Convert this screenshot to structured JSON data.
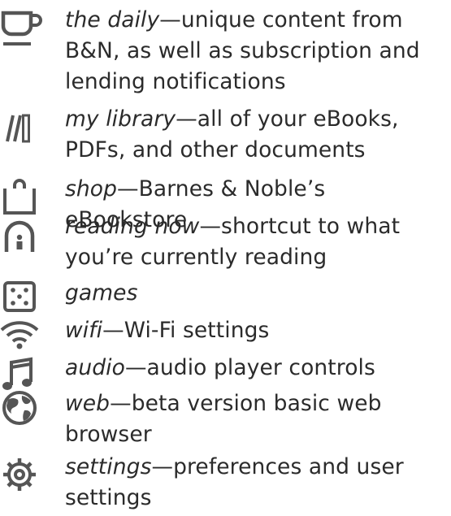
{
  "items": [
    {
      "term": "the daily",
      "desc": "—unique content from B&N, as well as subscription and lending notifications",
      "icon": "cup-icon"
    },
    {
      "term": "my library",
      "desc": "—all of your eBooks, PDFs, and other documents",
      "icon": "library-icon"
    },
    {
      "term": "shop",
      "desc": "—Barnes & Noble’s eBookstore",
      "icon": "shopping-bag-icon"
    },
    {
      "term": "reading now",
      "desc": "—shortcut to what you’re currently reading",
      "icon": "reading-now-icon"
    },
    {
      "term": "games",
      "desc": "",
      "icon": "dice-icon"
    },
    {
      "term": "wifi",
      "desc": "—Wi-Fi settings",
      "icon": "wifi-icon"
    },
    {
      "term": "audio",
      "desc": "—audio player controls",
      "icon": "music-note-icon"
    },
    {
      "term": "web",
      "desc": "—beta version basic web browser",
      "icon": "globe-icon"
    },
    {
      "term": "settings",
      "desc": "—preferences and user settings",
      "icon": "gear-icon"
    }
  ],
  "colors": {
    "text": "#2b2b2b",
    "icon": "#555555"
  }
}
